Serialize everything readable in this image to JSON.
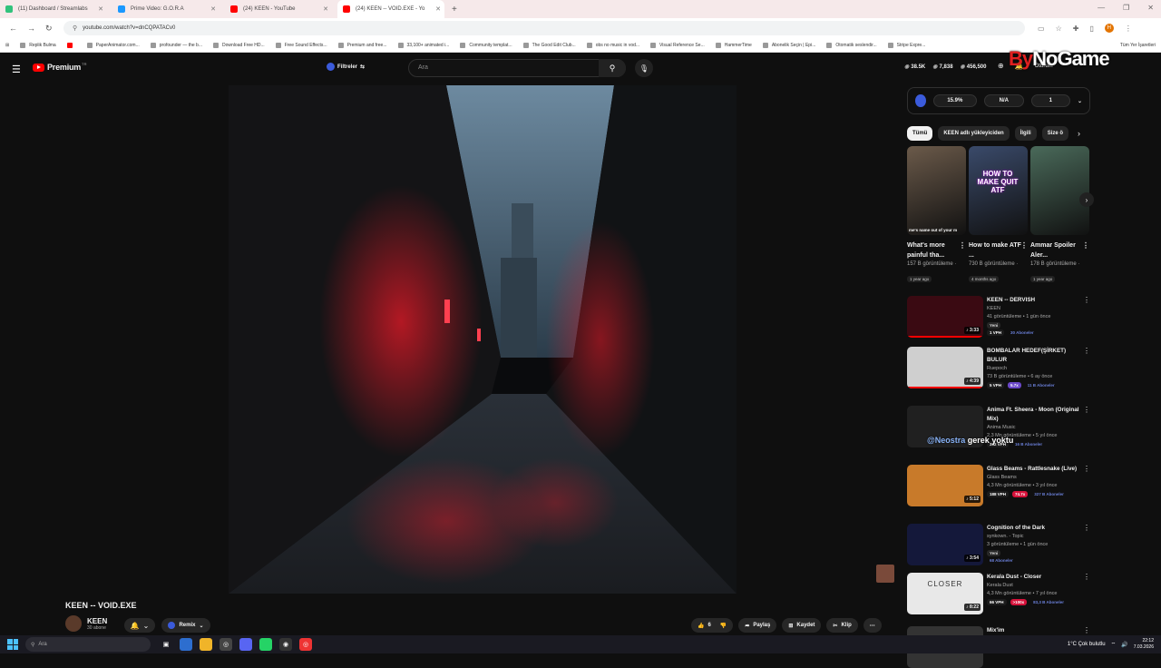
{
  "browser": {
    "tabs": [
      {
        "label": "(11) Dashboard / Streamlabs",
        "color": "#31c27c"
      },
      {
        "label": "Prime Video: G.O.R.A",
        "color": "#1a98ff"
      },
      {
        "label": "(24) KEEN - YouTube",
        "color": "#ff0000"
      },
      {
        "label": "(24) KEEN -- VOID.EXE - Yo",
        "color": "#ff0000"
      }
    ],
    "url": "youtube.com/watch?v=dnCQPATACv0",
    "profile_initial": "H",
    "bookmarks": [
      "Replik Bulma",
      "",
      "PaperAnimator.com...",
      "profounder — the b...",
      "Download Free HD...",
      "Free Sound Effects...",
      "Premium and free...",
      "33,100+ animated i...",
      "Community templat...",
      "The Good Edit Club...",
      "obs no music in vod...",
      "Visual Reference Se...",
      "HammerTime",
      "Abonelik Seçin | Epi...",
      "Otomatik seslendir...",
      "Stripe Expre..."
    ],
    "bookmarks_right": "Tüm Yer İşaretleri"
  },
  "header": {
    "logo": "Premium",
    "logo_sup": "TR",
    "filters": "Filtreler",
    "search_placeholder": "Ara",
    "stats": [
      "38.5K",
      "7,838",
      "456,500"
    ],
    "login": "Oturum"
  },
  "watermark": {
    "part1": "By",
    "part2": "NoGame"
  },
  "video": {
    "title": "KEEN -- VOID.EXE",
    "channel": "KEEN",
    "subs": "30 abone",
    "remix": "Remix",
    "likes": "6",
    "share": "Paylaş",
    "save": "Kaydet",
    "clip": "Klip"
  },
  "extension": {
    "pct": "15.9%",
    "na": "N/A",
    "num": "1"
  },
  "chips": [
    "Tümü",
    "KEEN adlı yükleyiciden",
    "İlgili",
    "Size ö"
  ],
  "shorts": [
    {
      "caption": "me's name out of your m",
      "title": "What's more painful tha...",
      "views": "157 B görüntüleme ·",
      "date": "1 year ago",
      "bg": "#6b5a4a"
    },
    {
      "caption": "",
      "title": "How to make ATF ...",
      "views": "730 B görüntüleme ·",
      "date": "4 months ago",
      "bg": "#3a4a6a",
      "thumb_text": "HOW TO MAKE QUIT ATF"
    },
    {
      "caption": "",
      "title": "Ammar Spoiler Aler...",
      "views": "178 B görüntüleme ·",
      "date": "1 year ago",
      "bg": "#4a6a5a"
    }
  ],
  "recommended": [
    {
      "title": "KEEN -- DERVISH",
      "channel": "KEEN",
      "meta": "41 görüntüleme • 1 gün önce",
      "badges": [
        [
          "yeni",
          "Yeni"
        ]
      ],
      "badges2": [
        [
          "vph",
          "1 VPH"
        ],
        [
          "ab",
          "30 Aboneler"
        ]
      ],
      "dur": "3:33",
      "bg": "#3a0a12"
    },
    {
      "title": "BOMBALAR HEDEF(ŞİRKET) BULUR",
      "channel": "Ruepoch",
      "meta": "73 B görüntüleme • 6 ay önce",
      "badges2": [
        [
          "vph",
          "5 VPH"
        ],
        [
          "pur",
          "5.7x"
        ],
        [
          "ab",
          "11 B Aboneler"
        ]
      ],
      "dur": "4:39",
      "bg": "#cfcfcf"
    },
    {
      "title": "Anima Ft. Sheera - Moon (Original Mix)",
      "channel": "Anima Music",
      "meta": "2,3 Mn görüntüleme • 5 yıl önce",
      "badges2": [
        [
          "vph",
          "332 VPH"
        ],
        [
          "ab",
          "16 B Aboneler"
        ]
      ],
      "dur": "",
      "bg": "#202020"
    },
    {
      "title": "Glass Beams - Rattlesnake (Live)",
      "channel": "Glass Beams",
      "meta": "4,3 Mn görüntüleme • 3 yıl önce",
      "badges2": [
        [
          "vph",
          "188 VPH"
        ],
        [
          "red",
          "74.7x"
        ],
        [
          "ab",
          "327 B Aboneler"
        ]
      ],
      "dur": "5:12",
      "bg": "#c87a2a"
    },
    {
      "title": "Cognition of the Dark",
      "channel": "synkown. - Topic",
      "meta": "3 görüntüleme • 1 gün önce",
      "badges": [
        [
          "yeni",
          "Yeni"
        ]
      ],
      "badges2": [
        [
          "ab",
          "68 Aboneler"
        ]
      ],
      "dur": "3:54",
      "bg": "#14183a"
    },
    {
      "title": "Kerala Dust - Closer",
      "channel": "Kerala Dust",
      "meta": "4,3 Mn görüntüleme • 7 yıl önce",
      "badges2": [
        [
          "vph",
          "66 VPH"
        ],
        [
          "red",
          ">100x"
        ],
        [
          "ab",
          "83,3 B Aboneler"
        ]
      ],
      "dur": "8:22",
      "bg": "#e8e8e8",
      "thumb_text": "CLOSER"
    },
    {
      "title": "Mix'im",
      "channel": "",
      "meta": "",
      "dur": "",
      "bg": "#333"
    }
  ],
  "overlay": {
    "at": "@Neostra",
    "rest": " gerek yoktu"
  },
  "taskbar": {
    "search": "Ara",
    "weather": "1°C  Çok bulutlu",
    "time": "22:12",
    "date": "7.03.2026"
  }
}
